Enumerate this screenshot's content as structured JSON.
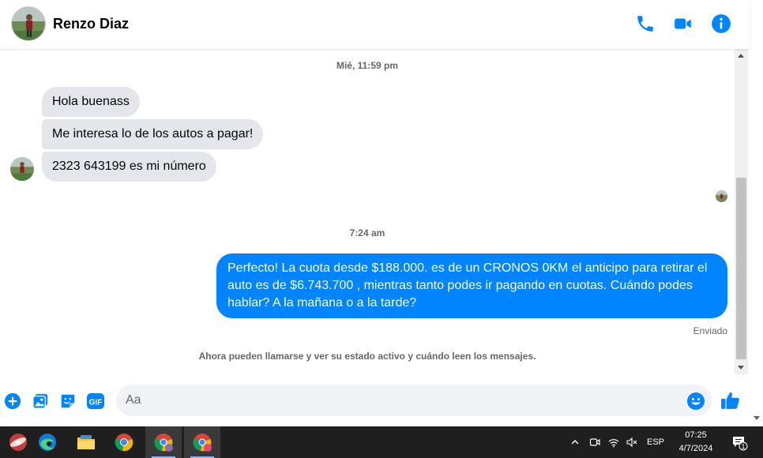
{
  "header": {
    "contact_name": "Renzo Diaz",
    "icons": [
      "phone-icon",
      "video-icon",
      "info-icon"
    ],
    "accent_color": "#0084ff"
  },
  "chat": {
    "timestamp_1": "Mié, 11:59 pm",
    "incoming": [
      "Hola buenass",
      "Me interesa lo de los autos a pagar!",
      "2323 643199 es mi número"
    ],
    "timestamp_2": "7:24 am",
    "outgoing": "Perfecto! La cuota desde $188.000. es de un CRONOS 0KM el anticipo para retirar el auto es de $6.743.700 , mientras tanto podes ir pagando en cuotas. Cuándo podes hablar? A la mañana o a la tarde?",
    "status": "Enviado",
    "notice": "Ahora pueden llamarse y ver su estado activo y cuándo leen los mensajes."
  },
  "composer": {
    "placeholder": "Aa",
    "icons": [
      "plus-icon",
      "image-icon",
      "sticker-icon",
      "gif-icon",
      "emoji-icon",
      "like-icon"
    ],
    "gif_label": "GIF"
  },
  "taskbar": {
    "apps": [
      "app-icon",
      "edge-icon",
      "file-explorer-icon",
      "chrome-icon",
      "chrome-profile-icon",
      "chrome-profile-c-icon"
    ],
    "language": "ESP",
    "time": "07:25",
    "date": "4/7/2024",
    "notification_count": "1"
  }
}
